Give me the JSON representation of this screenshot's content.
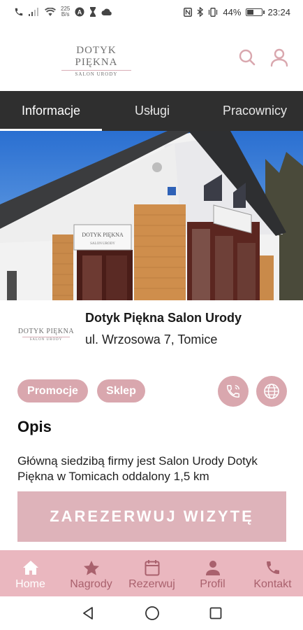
{
  "status_bar": {
    "net_speed_top": "225",
    "net_speed_bottom": "B/s",
    "battery_percent": "44%",
    "battery_level": 0.44,
    "time": "23:24"
  },
  "header": {
    "logo_main": "DOTYK PIĘKNA",
    "logo_sub": "SALON URODY",
    "icons": [
      "search-icon",
      "user-icon"
    ]
  },
  "tabs": [
    {
      "label": "Informacje",
      "active": true
    },
    {
      "label": "Usługi",
      "active": false
    },
    {
      "label": "Pracownicy",
      "active": false
    }
  ],
  "hero": {
    "sign_main": "DOTYK PIĘKNA",
    "sign_sub": "SALON URODY"
  },
  "salon": {
    "logo_main": "DOTYK PIĘKNA",
    "logo_sub": "SALON URODY",
    "name": "Dotyk Piękna Salon Urody",
    "address": "ul. Wrzosowa 7,  Tomice"
  },
  "chips": {
    "promo": "Promocje",
    "shop": "Sklep"
  },
  "actions": {
    "phone_icon": "phone-icon",
    "web_icon": "globe-icon"
  },
  "description": {
    "title": "Opis",
    "text": "Główną siedzibą firmy jest Salon Urody Dotyk Piękna w Tomicach oddalony 1,5 km"
  },
  "cta": {
    "label": "ZAREZERWUJ WIZYTĘ"
  },
  "bottom_nav": [
    {
      "label": "Home",
      "icon": "home-icon",
      "active": true
    },
    {
      "label": "Nagrody",
      "icon": "star-icon",
      "active": false
    },
    {
      "label": "Rezerwuj",
      "icon": "calendar-icon",
      "active": false
    },
    {
      "label": "Profil",
      "icon": "person-icon",
      "active": false
    },
    {
      "label": "Kontakt",
      "icon": "phone-icon",
      "active": false
    }
  ],
  "colors": {
    "accent": "#d9a7ae",
    "tab_bar": "#2f2f2f",
    "bottom_nav": "#eab7bf",
    "nav_label": "#a9616d"
  }
}
